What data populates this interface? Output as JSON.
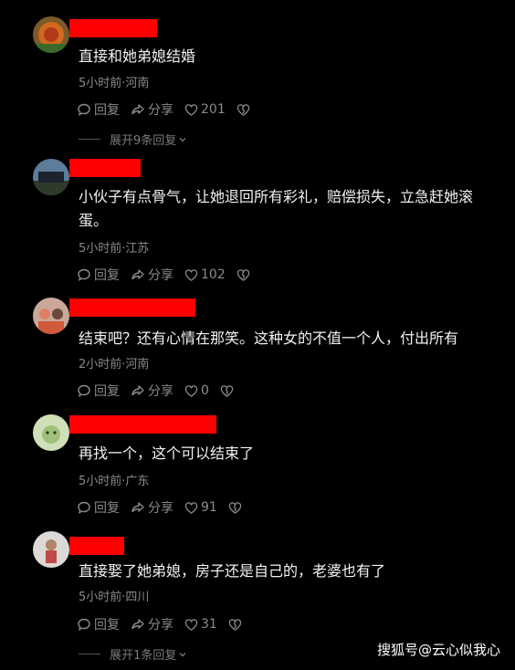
{
  "comments": [
    {
      "text": "直接和她弟媳结婚",
      "meta": "5小时前·河南",
      "reply_label": "回复",
      "share_label": "分享",
      "likes": "201",
      "expand_label": "展开9条回复"
    },
    {
      "text": "小伙子有点骨气，让她退回所有彩礼，赔偿损失，立急赶她滚蛋。",
      "meta": "5小时前·江苏",
      "reply_label": "回复",
      "share_label": "分享",
      "likes": "102"
    },
    {
      "text": "结束吧？还有心情在那笑。这种女的不值一个人，付出所有",
      "meta": "2小时前·河南",
      "reply_label": "回复",
      "share_label": "分享",
      "likes": "0"
    },
    {
      "text": "再找一个，这个可以结束了",
      "meta": "5小时前·广东",
      "reply_label": "回复",
      "share_label": "分享",
      "likes": "91"
    },
    {
      "text": "直接娶了她弟媳，房子还是自己的，老婆也有了",
      "meta": "5小时前·四川",
      "reply_label": "回复",
      "share_label": "分享",
      "likes": "31",
      "expand_label": "展开1条回复"
    }
  ],
  "watermark": "搜狐号@云心似我心",
  "colors": {
    "background": "#000000",
    "redact": "#ff0000",
    "meta": "#8a8a8a"
  }
}
